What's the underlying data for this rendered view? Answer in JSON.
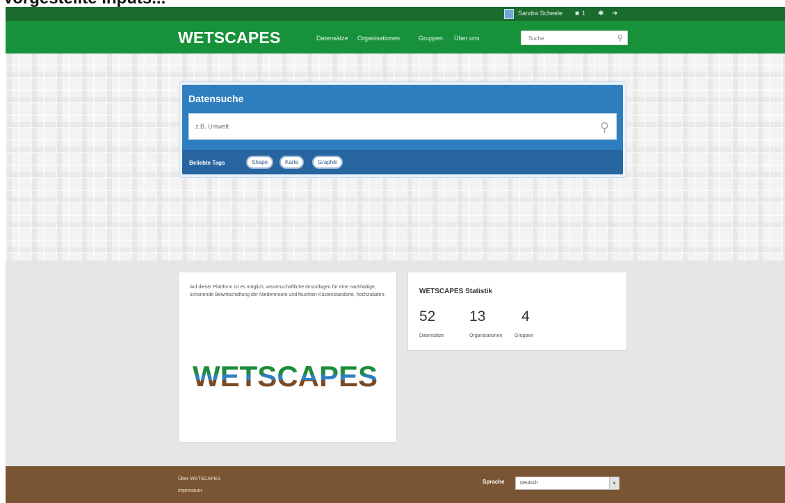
{
  "page_caption": "Vorgestellte Inputs...",
  "account": {
    "username": "Sandra Scheele",
    "notification_count": "1"
  },
  "header": {
    "logo": "WETSCAPES",
    "nav": [
      "Datensätze",
      "Organisationen",
      "Gruppen",
      "Über uns"
    ],
    "search_placeholder": "Suche"
  },
  "search": {
    "title": "Datensuche",
    "placeholder": "z.B. Umwelt",
    "tags_label": "Beliebte Tags",
    "tags": [
      "Shape",
      "Karte",
      "Graphik"
    ]
  },
  "intro": {
    "text": "Auf dieser Plattform ist es möglich, wissenschaftliche Grundlagen für eine nachhaltige, schonende Bewirtschaftung der Niedermoore und feuchten Küstenstandorte, hochzuladen.",
    "logo_text": "WETSCAPES",
    "logo_colors": [
      "#1e8c3a",
      "#2e7fc1",
      "#7a4a25"
    ]
  },
  "stats": {
    "title": "WETSCAPES Statistik",
    "items": [
      {
        "value": "52",
        "label": "Datensätze"
      },
      {
        "value": "13",
        "label": "Organisationen"
      },
      {
        "value": "4",
        "label": "Gruppen"
      }
    ]
  },
  "footer": {
    "links": [
      "Über WETSCAPES",
      "Impressum"
    ],
    "language_label": "Sprache",
    "language_value": "Deutsch"
  },
  "colors": {
    "account_bar": "#1a6b2e",
    "masthead": "#17923a",
    "search_panel": "#2f7fc0",
    "footer": "#7a5533"
  }
}
